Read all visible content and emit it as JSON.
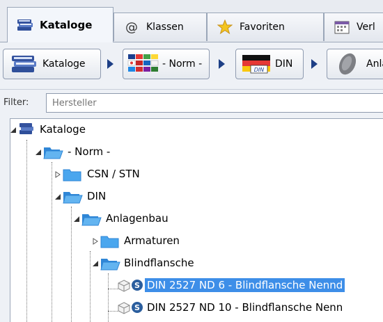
{
  "tabs": [
    {
      "label": "Kataloge",
      "icon": "books-icon",
      "active": true
    },
    {
      "label": "Klassen",
      "icon": "at-icon",
      "active": false
    },
    {
      "label": "Favoriten",
      "icon": "star-icon",
      "active": false
    },
    {
      "label": "Verl",
      "icon": "calendar-icon",
      "active": false
    }
  ],
  "breadcrumb": [
    {
      "label": "Kataloge",
      "icon": "books-icon"
    },
    {
      "label": "- Norm -",
      "icon": "flags-icon"
    },
    {
      "label": "DIN",
      "icon": "din-flag-icon",
      "badge": "DIN"
    },
    {
      "label": "Anla",
      "icon": "disc-icon"
    }
  ],
  "filter": {
    "label": "Filter:",
    "placeholder": "Hersteller"
  },
  "tree": {
    "nodes": [
      {
        "label": "Kataloge",
        "level": 0
      },
      {
        "label": "- Norm -",
        "level": 1
      },
      {
        "label": "CSN / STN",
        "level": 2
      },
      {
        "label": "DIN",
        "level": 2
      },
      {
        "label": "Anlagenbau",
        "level": 3
      },
      {
        "label": "Armaturen",
        "level": 4
      },
      {
        "label": "Blindflansche",
        "level": 4
      },
      {
        "label": "DIN 2527 ND 6 - Blindflansche Nennd",
        "level": 5,
        "selected": true
      },
      {
        "label": "DIN 2527 ND 10 - Blindflansche Nenn",
        "level": 5
      }
    ]
  },
  "colors": {
    "selection": "#3d8ee8",
    "folder": "#3fa0e6",
    "accent": "#1d3f86"
  }
}
